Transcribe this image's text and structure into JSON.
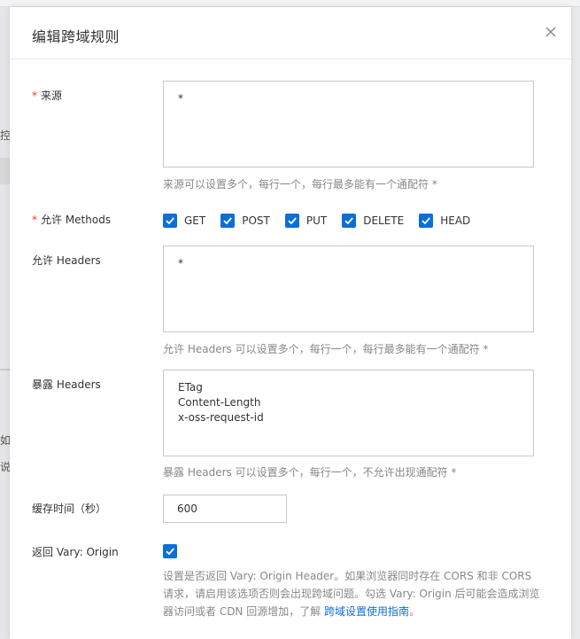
{
  "background": {
    "fragments": [
      "控",
      "如",
      "说"
    ]
  },
  "drawer": {
    "title": "编辑跨域规则"
  },
  "form": {
    "origin": {
      "required_mark": "*",
      "label": "来源",
      "value": "*",
      "hint": "来源可以设置多个，每行一个，每行最多能有一个通配符 *"
    },
    "methods": {
      "required_mark": "*",
      "label": "允许 Methods",
      "options": [
        {
          "label": "GET",
          "checked": true
        },
        {
          "label": "POST",
          "checked": true
        },
        {
          "label": "PUT",
          "checked": true
        },
        {
          "label": "DELETE",
          "checked": true
        },
        {
          "label": "HEAD",
          "checked": true
        }
      ]
    },
    "allow_headers": {
      "label": "允许 Headers",
      "value": "*",
      "hint": "允许 Headers 可以设置多个，每行一个，每行最多能有一个通配符 *"
    },
    "expose_headers": {
      "label": "暴露 Headers",
      "value": "ETag\nContent-Length\nx-oss-request-id",
      "hint": "暴露 Headers 可以设置多个，每行一个，不允许出现通配符 *"
    },
    "cache_time": {
      "label": "缓存时间（秒）",
      "value": "600"
    },
    "vary_origin": {
      "label": "返回 Vary: Origin",
      "checked": true,
      "description": "设置是否返回 Vary: Origin Header。如果浏览器同时存在 CORS 和非 CORS 请求，请启用该选项否则会出现跨域问题。勾选 Vary: Origin 后可能会造成浏览器访问或者 CDN 回源增加，了解 ",
      "link_text": "跨域设置使用指南",
      "tail": "。"
    }
  },
  "colors": {
    "accent": "#0b6fd6",
    "required": "#e03e2d",
    "hint": "#888888"
  }
}
